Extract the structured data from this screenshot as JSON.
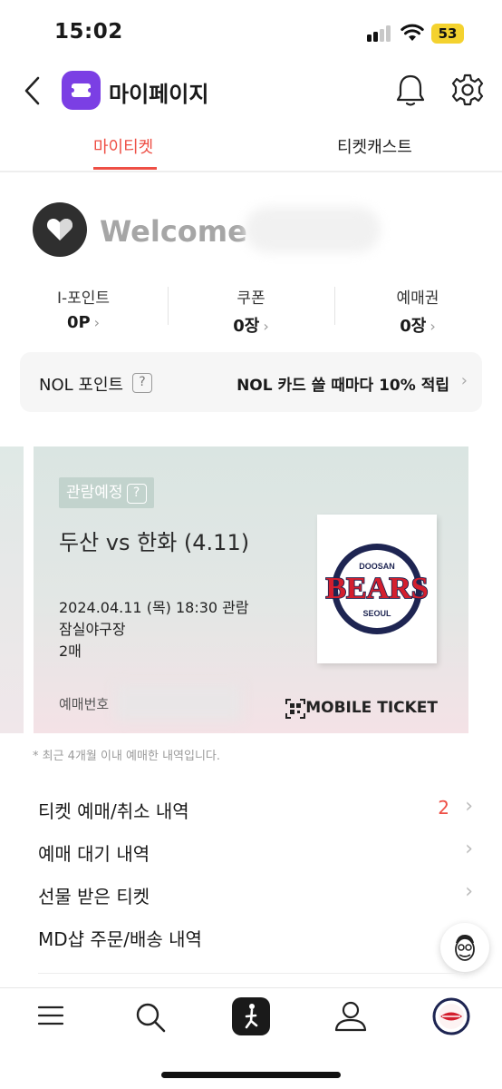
{
  "status_bar": {
    "time": "15:02",
    "battery": "53"
  },
  "header": {
    "title": "마이페이지"
  },
  "tabs": [
    {
      "label": "마이티켓"
    },
    {
      "label": "티켓캐스트"
    }
  ],
  "welcome": {
    "text": "Welcome"
  },
  "stats": [
    {
      "label": "I-포인트",
      "value": "0P"
    },
    {
      "label": "쿠폰",
      "value": "0장"
    },
    {
      "label": "예매권",
      "value": "0장"
    }
  ],
  "nol": {
    "label": "NOL 포인트",
    "help": "?",
    "promo": "NOL 카드 쓸 때마다 10% 적립"
  },
  "ticket": {
    "badge": "관람예정",
    "badge_help": "?",
    "title": "두산 vs 한화 (4.11)",
    "datetime": "2024.04.11 (목)  18:30 관람",
    "venue": "잠실야구장",
    "quantity": "2매",
    "booking_label": "예매번호",
    "mobile_ticket": "MOBILE TICKET",
    "logo_text": {
      "top": "DOOSAN",
      "main": "BEARS",
      "bottom": "SEOUL"
    }
  },
  "footnote": "* 최근 4개월 이내 예매한 내역입니다.",
  "menu": [
    {
      "label": "티켓 예매/취소 내역",
      "count": "2"
    },
    {
      "label": "예매 대기 내역"
    },
    {
      "label": "선물 받은 티켓"
    },
    {
      "label": "MD샵 주문/배송 내역"
    }
  ],
  "colors": {
    "accent": "#ee4f45",
    "brand": "#7b3fe4",
    "bears_navy": "#1e2552",
    "bears_red": "#d31f2e"
  },
  "icons": {
    "header": [
      "back-icon",
      "app-logo-icon",
      "bell-icon",
      "gear-icon"
    ],
    "bottom_nav": [
      "menu-icon",
      "search-icon",
      "home-icon",
      "profile-icon",
      "team-logo-icon"
    ]
  }
}
